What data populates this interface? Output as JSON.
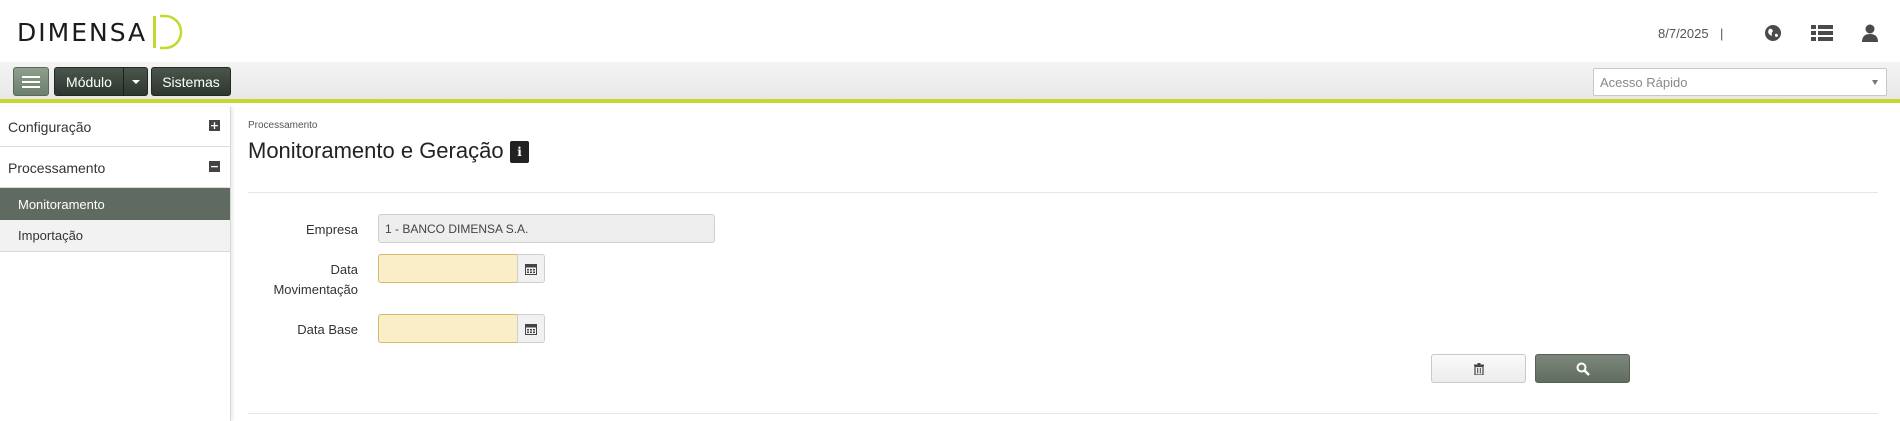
{
  "header": {
    "logo_text": "DIMENSA",
    "date": "8/7/2025",
    "separator": "|",
    "icons": [
      "globe-icon",
      "list-icon",
      "user-icon"
    ]
  },
  "toolbar": {
    "menu_icon": "hamburger-icon",
    "modulo_label": "Módulo",
    "sistemas_label": "Sistemas",
    "quick_access_placeholder": "Acesso Rápido"
  },
  "sidebar": {
    "groups": [
      {
        "label": "Configuração",
        "toggle": "+"
      },
      {
        "label": "Processamento",
        "toggle": "−"
      }
    ],
    "items": [
      {
        "label": "Monitoramento",
        "active": true
      },
      {
        "label": "Importação",
        "active": false
      }
    ]
  },
  "main": {
    "breadcrumb": "Processamento",
    "title": "Monitoramento e Geração",
    "info_icon": "i",
    "form": {
      "empresa_label": "Empresa",
      "empresa_value": "1 - BANCO DIMENSA S.A.",
      "data_mov_label_1": "Data",
      "data_mov_label_2": "Movimentação",
      "data_mov_value": "",
      "data_base_label": "Data Base",
      "data_base_value": ""
    },
    "actions": {
      "clear_icon": "trash-icon",
      "search_icon": "search-icon"
    }
  },
  "colors": {
    "accent": "#c4d82d",
    "sidebar_active": "#5f6b60",
    "dark_button": "#2e372f",
    "date_field": "#f9eec8"
  }
}
